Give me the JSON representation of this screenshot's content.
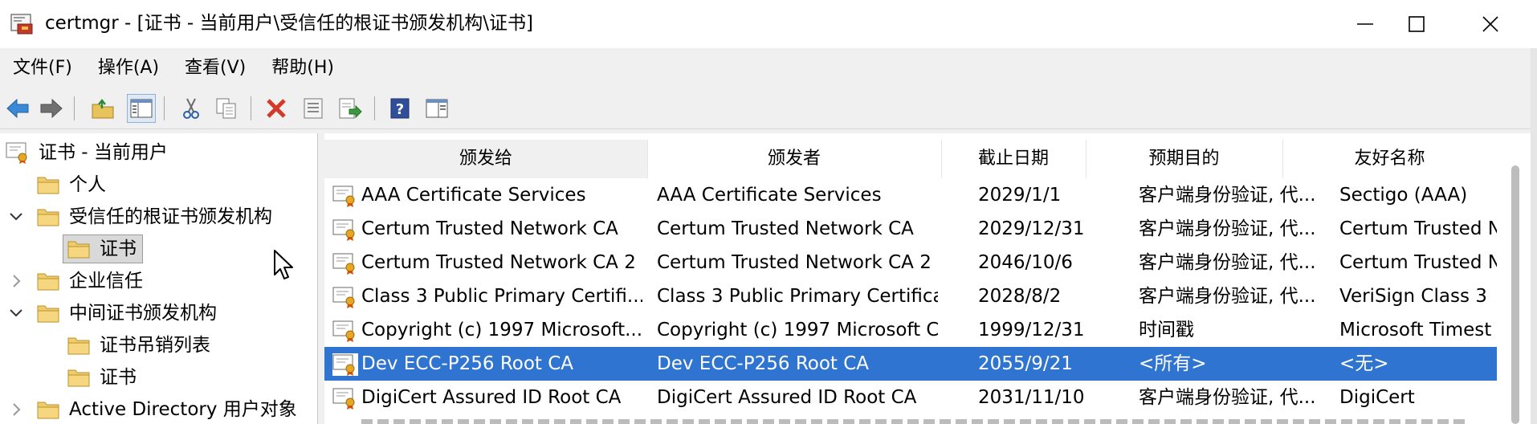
{
  "window": {
    "title": "certmgr - [证书 - 当前用户\\受信任的根证书颁发机构\\证书]",
    "app_icon": "certmgr-icon",
    "controls": [
      "minimize-icon",
      "maximize-icon",
      "close-icon"
    ]
  },
  "menu": [
    {
      "label": "文件(F)"
    },
    {
      "label": "操作(A)"
    },
    {
      "label": "查看(V)"
    },
    {
      "label": "帮助(H)"
    }
  ],
  "toolbar": {
    "buttons": [
      "back-arrow-icon",
      "forward-arrow-icon",
      "up-folder-icon",
      "show-hide-tree-icon",
      "cut-icon",
      "copy-icon",
      "delete-icon",
      "properties-icon",
      "export-icon",
      "help-icon",
      "console-icon"
    ],
    "pressed": "show-hide-tree-icon"
  },
  "tree": {
    "root": "证书 - 当前用户",
    "items": [
      {
        "label": "个人",
        "expander": "none"
      },
      {
        "label": "受信任的根证书颁发机构",
        "expander": "expanded"
      },
      {
        "label": "证书",
        "expander": "none",
        "selected": true
      },
      {
        "label": "企业信任",
        "expander": "collapsed"
      },
      {
        "label": "中间证书颁发机构",
        "expander": "expanded"
      },
      {
        "label": "证书吊销列表",
        "expander": "none"
      },
      {
        "label": "证书",
        "expander": "none"
      },
      {
        "label": "Active Directory 用户对象",
        "expander": "collapsed"
      }
    ]
  },
  "list": {
    "columns": [
      "颁发给",
      "颁发者",
      "截止日期",
      "预期目的",
      "友好名称"
    ],
    "sorted_column": "颁发给",
    "rows": [
      [
        "AAA Certificate Services",
        "AAA Certificate Services",
        "2029/1/1",
        "客户端身份验证, 代...",
        "Sectigo (AAA)"
      ],
      [
        "Certum Trusted Network CA",
        "Certum Trusted Network CA",
        "2029/12/31",
        "客户端身份验证, 代...",
        "Certum Trusted N"
      ],
      [
        "Certum Trusted Network CA 2",
        "Certum Trusted Network CA 2",
        "2046/10/6",
        "客户端身份验证, 代...",
        "Certum Trusted N"
      ],
      [
        "Class 3 Public Primary Certifi...",
        "Class 3 Public Primary Certifica...",
        "2028/8/2",
        "客户端身份验证, 代...",
        "VeriSign Class 3"
      ],
      [
        "Copyright (c) 1997 Microsoft...",
        "Copyright (c) 1997 Microsoft C...",
        "1999/12/31",
        "时间戳",
        "Microsoft Timest"
      ],
      [
        "Dev ECC-P256 Root CA",
        "Dev ECC-P256 Root CA",
        "2055/9/21",
        "<所有>",
        "<无>"
      ],
      [
        "DigiCert Assured ID Root CA",
        "DigiCert Assured ID Root CA",
        "2031/11/10",
        "客户端身份验证, 代...",
        "DigiCert"
      ]
    ],
    "selected_row": 5,
    "selection_color": "#2f74d0"
  }
}
